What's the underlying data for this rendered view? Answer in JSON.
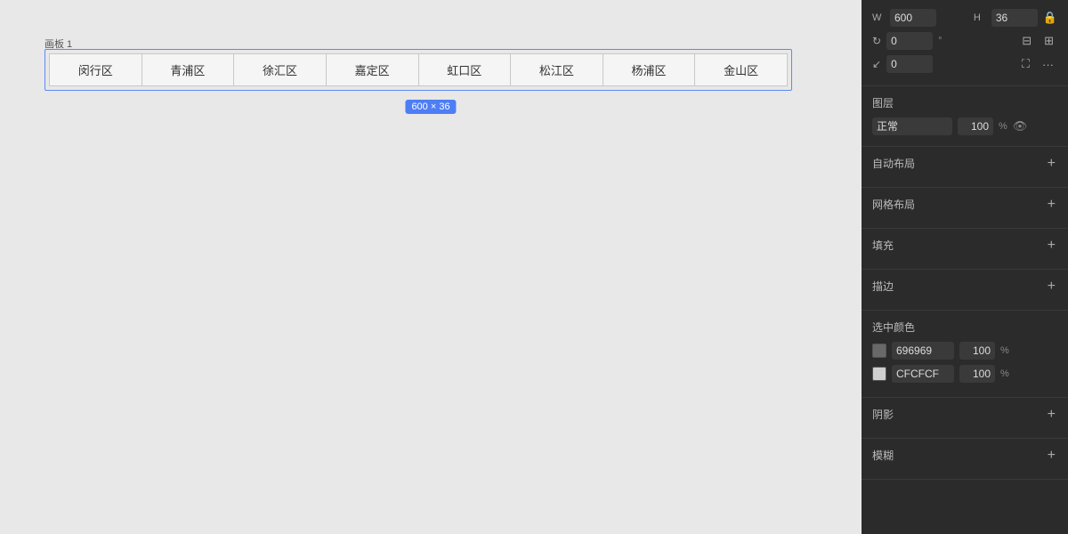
{
  "canvas": {
    "panel_label": "画板 1",
    "size_badge": "600 × 36",
    "tabs": [
      {
        "label": "闵行区"
      },
      {
        "label": "青浦区"
      },
      {
        "label": "徐汇区"
      },
      {
        "label": "嘉定区"
      },
      {
        "label": "虹口区"
      },
      {
        "label": "松江区"
      },
      {
        "label": "杨浦区"
      },
      {
        "label": "金山区"
      }
    ]
  },
  "right_panel": {
    "w_label": "W",
    "h_label": "H",
    "w_value": "600",
    "h_value": "36",
    "rotate_value": "0",
    "corner_value": "0",
    "layer_section": "图层",
    "layer_mode": "正常",
    "layer_opacity": "100",
    "layer_opacity_unit": "%",
    "auto_layout_label": "自动布局",
    "grid_layout_label": "网格布局",
    "fill_label": "填充",
    "stroke_label": "描边",
    "color_section_label": "选中颜色",
    "colors": [
      {
        "hex": "696969",
        "opacity": "100",
        "swatch": "#696969"
      },
      {
        "hex": "CFCFCF",
        "opacity": "100",
        "swatch": "#CFCFCF"
      }
    ],
    "shadow_label": "阴影",
    "blur_label": "模糊"
  }
}
